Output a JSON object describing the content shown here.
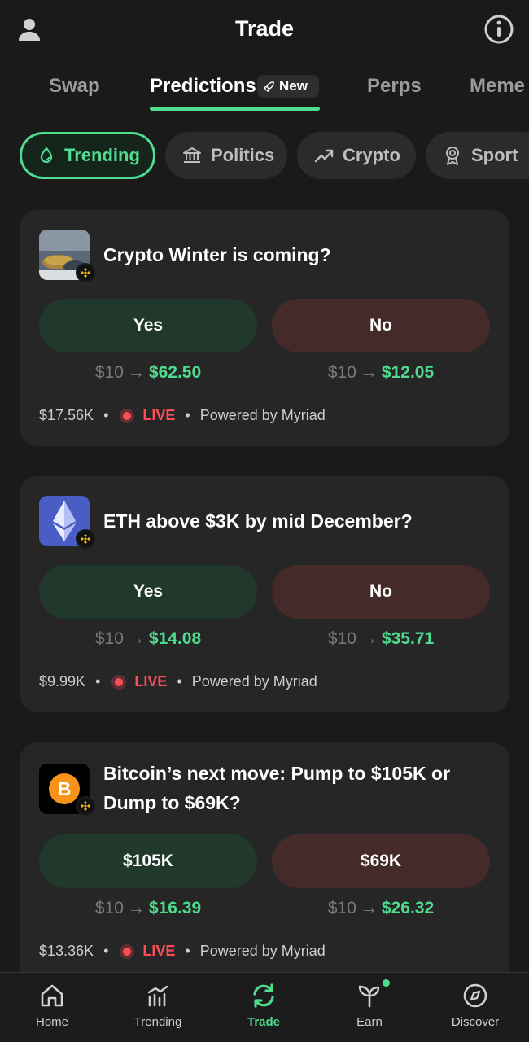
{
  "header": {
    "title": "Trade"
  },
  "tabs": [
    {
      "label": "Swap"
    },
    {
      "label": "Predictions",
      "badge": "New"
    },
    {
      "label": "Perps"
    },
    {
      "label": "Meme"
    }
  ],
  "categories": [
    {
      "label": "Trending",
      "icon": "droplet-icon"
    },
    {
      "label": "Politics",
      "icon": "bank-icon"
    },
    {
      "label": "Crypto",
      "icon": "trend-up-icon"
    },
    {
      "label": "Sport",
      "icon": "award-icon"
    }
  ],
  "markets": [
    {
      "question": "Crypto Winter is coming?",
      "option_a": "Yes",
      "option_b": "No",
      "stake": "$10",
      "payout_a": "$62.50",
      "payout_b": "$12.05",
      "volume": "$17.56K",
      "status": "LIVE",
      "powered": "Powered by Myriad"
    },
    {
      "question": "ETH above $3K by mid December?",
      "option_a": "Yes",
      "option_b": "No",
      "stake": "$10",
      "payout_a": "$14.08",
      "payout_b": "$35.71",
      "volume": "$9.99K",
      "status": "LIVE",
      "powered": "Powered by Myriad"
    },
    {
      "question_line1": "Bitcoin’s next move: Pump to $105K or",
      "question_line2": "Dump to $69K?",
      "option_a": "$105K",
      "option_b": "$69K",
      "stake": "$10",
      "payout_a": "$16.39",
      "payout_b": "$26.32",
      "volume": "$13.36K",
      "status": "LIVE",
      "powered": "Powered by Myriad"
    }
  ],
  "nav": [
    {
      "label": "Home"
    },
    {
      "label": "Trending"
    },
    {
      "label": "Trade"
    },
    {
      "label": "Earn"
    },
    {
      "label": "Discover"
    }
  ],
  "colors": {
    "accent": "#4fdc8f",
    "live": "#ff4d57",
    "yes_bg": "#21392c",
    "no_bg": "#452a2a"
  }
}
